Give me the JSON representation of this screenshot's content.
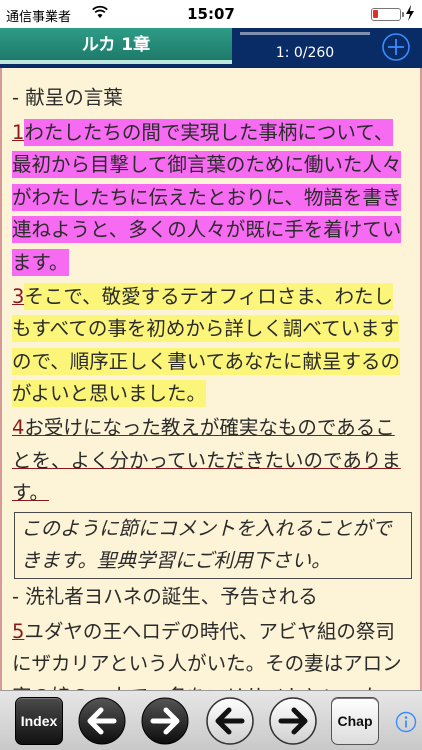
{
  "status_bar": {
    "carrier": "通信事業者",
    "time": "15:07"
  },
  "nav": {
    "chapter_title": "ルカ 1章",
    "verse_counter": "1: 0/260",
    "progress_fraction": 0.0
  },
  "content": {
    "heading1": "- 献呈の言葉",
    "verses": [
      {
        "num": "1",
        "text": "わたしたちの間で実現した事柄について、最初から目撃して御言葉のために働いた人々がわたしたちに伝えたとおりに、物語を書き連ねようと、多くの人々が既に手を着けています。",
        "highlight": "magenta"
      },
      {
        "num": "3",
        "text": "そこで、敬愛するテオフィロさま、わたしもすべての事を初めから詳しく調べていますので、順序正しく書いてあなたに献呈するのがよいと思いました。",
        "highlight": "yellow"
      },
      {
        "num": "4",
        "text": "お受けになった教えが確実なものであることを、よく分かっていただきたいのであります。",
        "highlight": "underline"
      }
    ],
    "comment": "このように節にコメントを入れることができます。聖典学習にご利用下さい。",
    "heading2": "- 洗礼者ヨハネの誕生、予告される",
    "verse5": {
      "num": "5",
      "text": "ユダヤの王ヘロデの時代、アビヤ組の祭司にザカリアという人がいた。その妻はアロン家の娘の一人で、名をエリサベトといった。"
    }
  },
  "toolbar": {
    "index_label": "Index",
    "chap_label": "Chap"
  },
  "colors": {
    "nav_bg": "#0a2c66",
    "tab_green": "#2e9c86",
    "page_bg": "#fdf3d6",
    "highlight_magenta": "#f76bf3",
    "highlight_yellow": "#fbf57a",
    "accent_blue": "#3b8cff"
  }
}
